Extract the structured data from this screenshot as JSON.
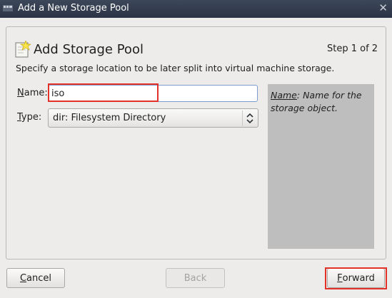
{
  "window": {
    "title": "Add a New Storage Pool",
    "close_glyph": "✕"
  },
  "header": {
    "title": "Add Storage Pool",
    "step": "Step 1 of 2"
  },
  "description": "Specify a storage location to be later split into virtual machine storage.",
  "form": {
    "name_label_accel": "N",
    "name_label_rest": "ame:",
    "name_value": "iso",
    "type_label_accel": "T",
    "type_label_rest": "ype:",
    "type_value": "dir: Filesystem Directory"
  },
  "help": {
    "term": "Name",
    "text": ": Name for the storage object."
  },
  "buttons": {
    "cancel_accel": "C",
    "cancel_rest": "ancel",
    "back_label": "Back",
    "forward_accel": "F",
    "forward_rest": "orward"
  },
  "colors": {
    "highlight": "#e3312a",
    "help_bg": "#bebebe",
    "titlebar": "#2f3849"
  }
}
